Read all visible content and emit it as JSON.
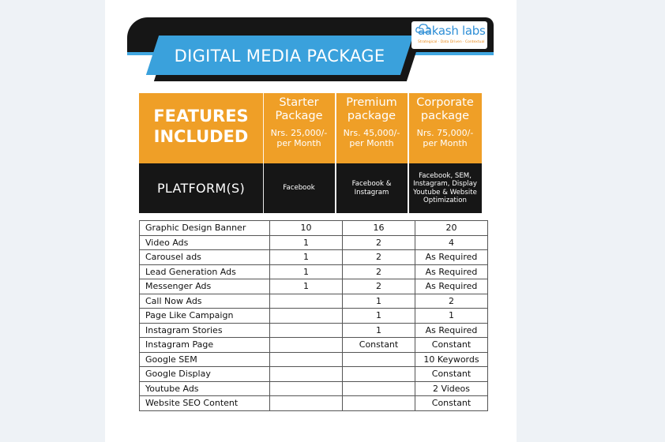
{
  "header": {
    "title": "DIGITAL MEDIA PACKAGE",
    "logo": {
      "text": "aakash labs",
      "tagline": "Strategical · Data Driven · Contextual",
      "colors": {
        "text": "#2f8fd6",
        "tagline": "#e88a1a"
      }
    }
  },
  "colors": {
    "orange": "#ef9f27",
    "black": "#161616",
    "blue": "#3aa1dc"
  },
  "features_heading": {
    "line1": "FEATURES",
    "line2": "INCLUDED"
  },
  "platform_heading": "PLATFORM(S)",
  "packages": [
    {
      "name_line1": "Starter",
      "name_line2": "Package",
      "price_line1": "Nrs. 25,000/-",
      "price_line2": "per Month",
      "platforms": [
        "Facebook"
      ]
    },
    {
      "name_line1": "Premium",
      "name_line2": "package",
      "price_line1": "Nrs. 45,000/-",
      "price_line2": "per Month",
      "platforms": [
        "Facebook &",
        "Instagram"
      ]
    },
    {
      "name_line1": "Corporate",
      "name_line2": "package",
      "price_line1": "Nrs. 75,000/-",
      "price_line2": "per Month",
      "platforms": [
        "Facebook, SEM,",
        "Instagram, Display",
        "Youtube & Website",
        "Optimization"
      ]
    }
  ],
  "features": [
    {
      "name": "Graphic Design Banner",
      "values": [
        "10",
        "16",
        "20"
      ]
    },
    {
      "name": "Video Ads",
      "values": [
        "1",
        "2",
        "4"
      ]
    },
    {
      "name": "Carousel ads",
      "values": [
        "1",
        "2",
        "As Required"
      ]
    },
    {
      "name": "Lead Generation Ads",
      "values": [
        "1",
        "2",
        "As Required"
      ]
    },
    {
      "name": "Messenger Ads",
      "values": [
        "1",
        "2",
        "As Required"
      ]
    },
    {
      "name": "Call Now Ads",
      "values": [
        "",
        "1",
        "2"
      ]
    },
    {
      "name": "Page Like Campaign",
      "values": [
        "",
        "1",
        "1"
      ]
    },
    {
      "name": "Instagram Stories",
      "values": [
        "",
        "1",
        "As Required"
      ]
    },
    {
      "name": "Instagram Page",
      "values": [
        "",
        "Constant",
        "Constant"
      ]
    },
    {
      "name": "Google SEM",
      "values": [
        "",
        "",
        "10 Keywords"
      ]
    },
    {
      "name": "Google Display",
      "values": [
        "",
        "",
        "Constant"
      ]
    },
    {
      "name": "Youtube Ads",
      "values": [
        "",
        "",
        "2 Videos"
      ]
    },
    {
      "name": "Website SEO Content",
      "values": [
        "",
        "",
        "Constant"
      ]
    }
  ]
}
